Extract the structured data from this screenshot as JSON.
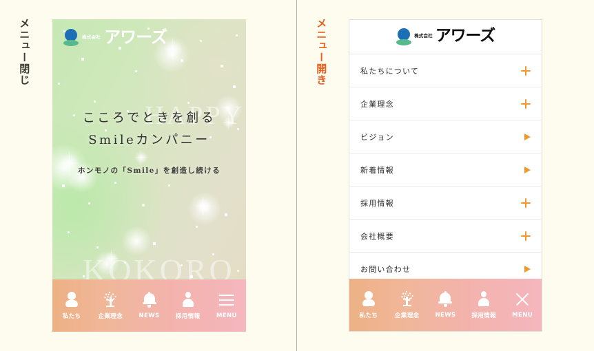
{
  "annotations": {
    "left_label": "メニュー閉じ",
    "right_label": "メニュー開き",
    "left_label_color": "#3b3a33",
    "right_label_color": "#e8601f"
  },
  "brand": {
    "kabushiki": "株式会社",
    "wordmark": "アワーズ"
  },
  "hero": {
    "headline_line1": "こころでときを創る",
    "headline_line2": "Smileカンパニー",
    "subline": "ホンモノの「Smile」を創造し続ける",
    "watermark_top": "HAPPY",
    "watermark_bottom": "KOKORO",
    "gradient_start": "#c6e8b4",
    "gradient_end": "#e4ddc6"
  },
  "menu": {
    "items": [
      {
        "label": "私たちについて",
        "icon": "plus-icon"
      },
      {
        "label": "企業理念",
        "icon": "plus-icon"
      },
      {
        "label": "ビジョン",
        "icon": "arrow-right-icon"
      },
      {
        "label": "新着情報",
        "icon": "arrow-right-icon"
      },
      {
        "label": "採用情報",
        "icon": "plus-icon"
      },
      {
        "label": "会社概要",
        "icon": "plus-icon"
      },
      {
        "label": "お問い合わせ",
        "icon": "arrow-right-icon"
      }
    ],
    "accent_color": "#f0982c"
  },
  "navbar": {
    "gradient_start": "#eeb185",
    "gradient_end": "#f5b6be",
    "items_closed": [
      {
        "label": "私たち",
        "icon": "person-icon"
      },
      {
        "label": "企業理念",
        "icon": "tree-icon"
      },
      {
        "label": "NEWS",
        "icon": "bell-icon"
      },
      {
        "label": "採用情報",
        "icon": "bust-icon"
      },
      {
        "label": "MENU",
        "icon": "hamburger-icon"
      }
    ],
    "items_open": [
      {
        "label": "私たち",
        "icon": "person-icon"
      },
      {
        "label": "企業理念",
        "icon": "tree-icon"
      },
      {
        "label": "NEWS",
        "icon": "bell-icon"
      },
      {
        "label": "採用情報",
        "icon": "bust-icon"
      },
      {
        "label": "MENU",
        "icon": "close-icon"
      }
    ]
  }
}
